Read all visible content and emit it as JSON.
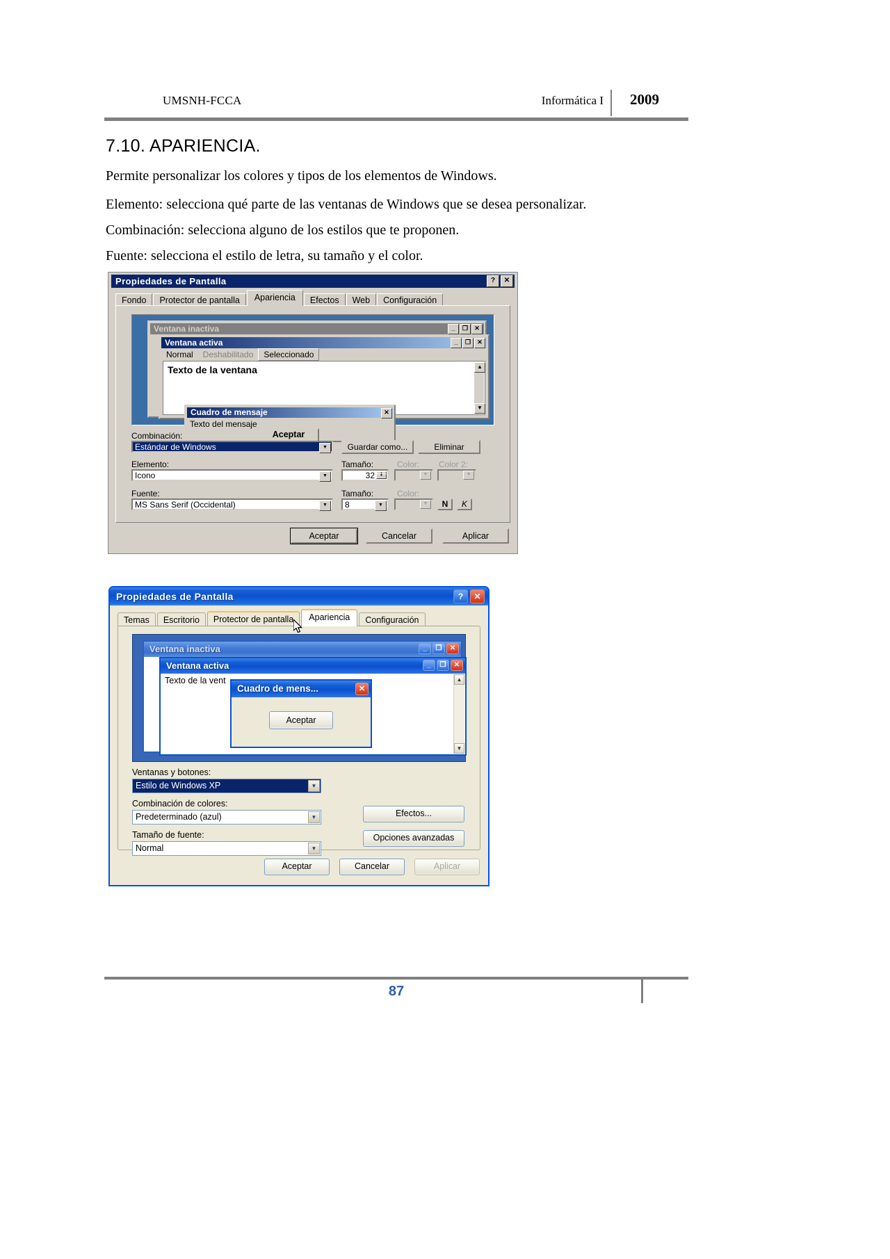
{
  "header": {
    "left": "UMSNH-FCCA",
    "course": "Informática I",
    "year": "2009"
  },
  "footer": {
    "page_number": "87",
    "accent_color": "#2f5fa8"
  },
  "content": {
    "section_title": "7.10. APARIENCIA.",
    "paragraphs": [
      "Permite personalizar los colores y tipos de los elementos de Windows.",
      "Elemento: selecciona qué parte de las ventanas de Windows que se desea personalizar.",
      "Combinación: selecciona alguno de los estilos que te proponen.",
      "Fuente: selecciona el estilo de letra, su tamaño y el color."
    ]
  },
  "classic_dialog": {
    "title": "Propiedades de Pantalla",
    "titlebar_buttons": {
      "help": "?",
      "close": "✕"
    },
    "tabs": [
      {
        "label": "Fondo",
        "active": false
      },
      {
        "label": "Protector de pantalla",
        "active": false
      },
      {
        "label": "Apariencia",
        "active": true
      },
      {
        "label": "Efectos",
        "active": false
      },
      {
        "label": "Web",
        "active": false
      },
      {
        "label": "Configuración",
        "active": false
      }
    ],
    "preview": {
      "inactive_window_title": "Ventana inactiva",
      "active_window_title": "Ventana activa",
      "menu": {
        "normal": "Normal",
        "disabled": "Deshabilitado",
        "selected": "Seleccionado"
      },
      "window_text": "Texto de la ventana",
      "messagebox": {
        "title": "Cuadro de mensaje",
        "close": "✕",
        "text": "Texto del mensaje",
        "ok": "Aceptar"
      },
      "window_buttons": {
        "minimize": "_",
        "maximize": "❐",
        "close": "✕"
      },
      "scroll_up": "▲",
      "scroll_down": "▼"
    },
    "controls": {
      "combination_label": "Combinación:",
      "combination_value": "Estándar de Windows",
      "save_as_button": "Guardar como...",
      "delete_button": "Eliminar",
      "element_label": "Elemento:",
      "element_value": "Icono",
      "size_label": "Tamaño:",
      "size_value": "32",
      "color_label": "Color:",
      "color2_label": "Color 2:",
      "font_label": "Fuente:",
      "font_value": "MS Sans Serif (Occidental)",
      "font_size_label": "Tamaño:",
      "font_size_value": "8",
      "font_color_label": "Color:",
      "bold_button": "N",
      "italic_button": "K",
      "dropdown_arrow": "▼",
      "spin_up": "▲",
      "spin_down": "▼"
    },
    "buttons": {
      "accept": "Aceptar",
      "cancel": "Cancelar",
      "apply": "Aplicar"
    }
  },
  "xp_dialog": {
    "title": "Propiedades de Pantalla",
    "titlebar_buttons": {
      "help": "?",
      "close": "✕"
    },
    "tabs": [
      {
        "label": "Temas",
        "active": false
      },
      {
        "label": "Escritorio",
        "active": false
      },
      {
        "label": "Protector de pantalla",
        "active": false,
        "hover": true
      },
      {
        "label": "Apariencia",
        "active": true
      },
      {
        "label": "Configuración",
        "active": false
      }
    ],
    "preview": {
      "inactive_window_title": "Ventana inactiva",
      "active_window_title": "Ventana activa",
      "window_text": "Texto de la vent",
      "messagebox": {
        "title": "Cuadro de mens...",
        "close": "✕",
        "ok": "Aceptar"
      },
      "window_buttons": {
        "minimize": "_",
        "maximize": "❐",
        "close": "✕"
      },
      "scroll_up": "▲",
      "scroll_down": "▼"
    },
    "controls": {
      "windows_buttons_label": "Ventanas y botones:",
      "windows_buttons_value": "Estilo de Windows XP",
      "color_scheme_label": "Combinación de colores:",
      "color_scheme_value": "Predeterminado (azul)",
      "font_size_label": "Tamaño de fuente:",
      "font_size_value": "Normal",
      "effects_button": "Efectos...",
      "advanced_button": "Opciones avanzadas",
      "dropdown_arrow": "▼"
    },
    "buttons": {
      "accept": "Aceptar",
      "cancel": "Cancelar",
      "apply": "Aplicar"
    }
  }
}
